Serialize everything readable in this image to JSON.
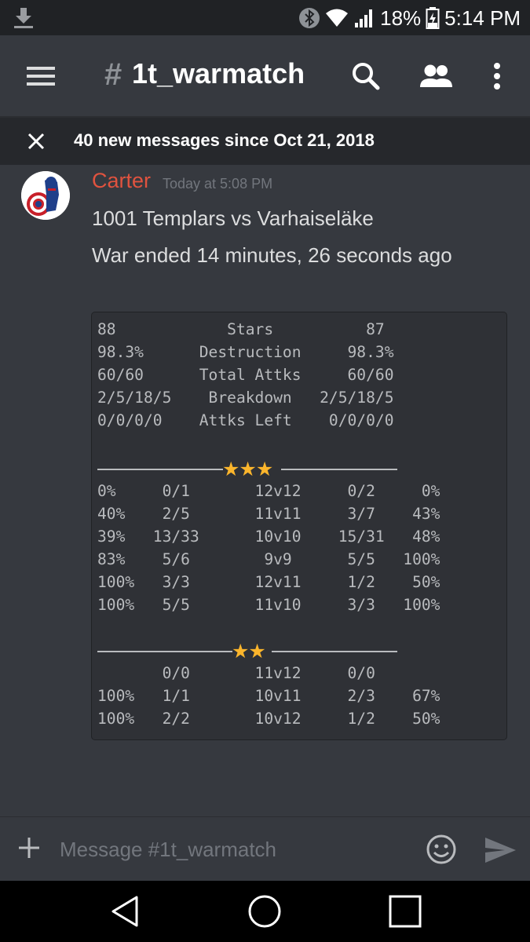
{
  "status": {
    "battery": "18%",
    "time": "5:14 PM",
    "icons": [
      "download-icon",
      "bluetooth-icon",
      "wifi-icon",
      "signal-icon",
      "battery-icon"
    ]
  },
  "header": {
    "hash": "#",
    "channel": "1t_warmatch",
    "icons": [
      "menu-icon",
      "search-icon",
      "members-icon",
      "more-vert-icon"
    ]
  },
  "new_messages": {
    "text": "40 new messages since Oct 21, 2018"
  },
  "message": {
    "author": "Carter",
    "timestamp": "Today at 5:08 PM",
    "line1": "1001 Templars vs Varhaiseläke",
    "line2": "War ended 14 minutes, 26 seconds ago",
    "summary": "88            Stars          87\n98.3%      Destruction     98.3%\n60/60      Total Attks     60/60\n2/5/18/5    Breakdown   2/5/18/5\n0/0/0/0    Attks Left    0/0/0/0",
    "three_star_label": "★★★",
    "three_star_rows": "0%     0/1       12v12     0/2     0%\n40%    2/5       11v11     3/7    43%\n39%   13/33      10v10    15/31   48%\n83%    5/6        9v9      5/5   100%\n100%   3/3       12v11     1/2    50%\n100%   5/5       11v10     3/3   100%",
    "two_star_label": "★★",
    "two_star_rows": "       0/0       11v12     0/0\n100%   1/1       10v11     2/3    67%\n100%   2/2       10v12     1/2    50%"
  },
  "input": {
    "placeholder": "Message #1t_warmatch"
  },
  "navigation": {
    "icons": [
      "back-icon",
      "home-icon",
      "recents-icon"
    ]
  },
  "colors": {
    "background": "#36393f",
    "author": "#e0533f",
    "codeblock": "#2f3136",
    "star": "#fbb52c"
  }
}
